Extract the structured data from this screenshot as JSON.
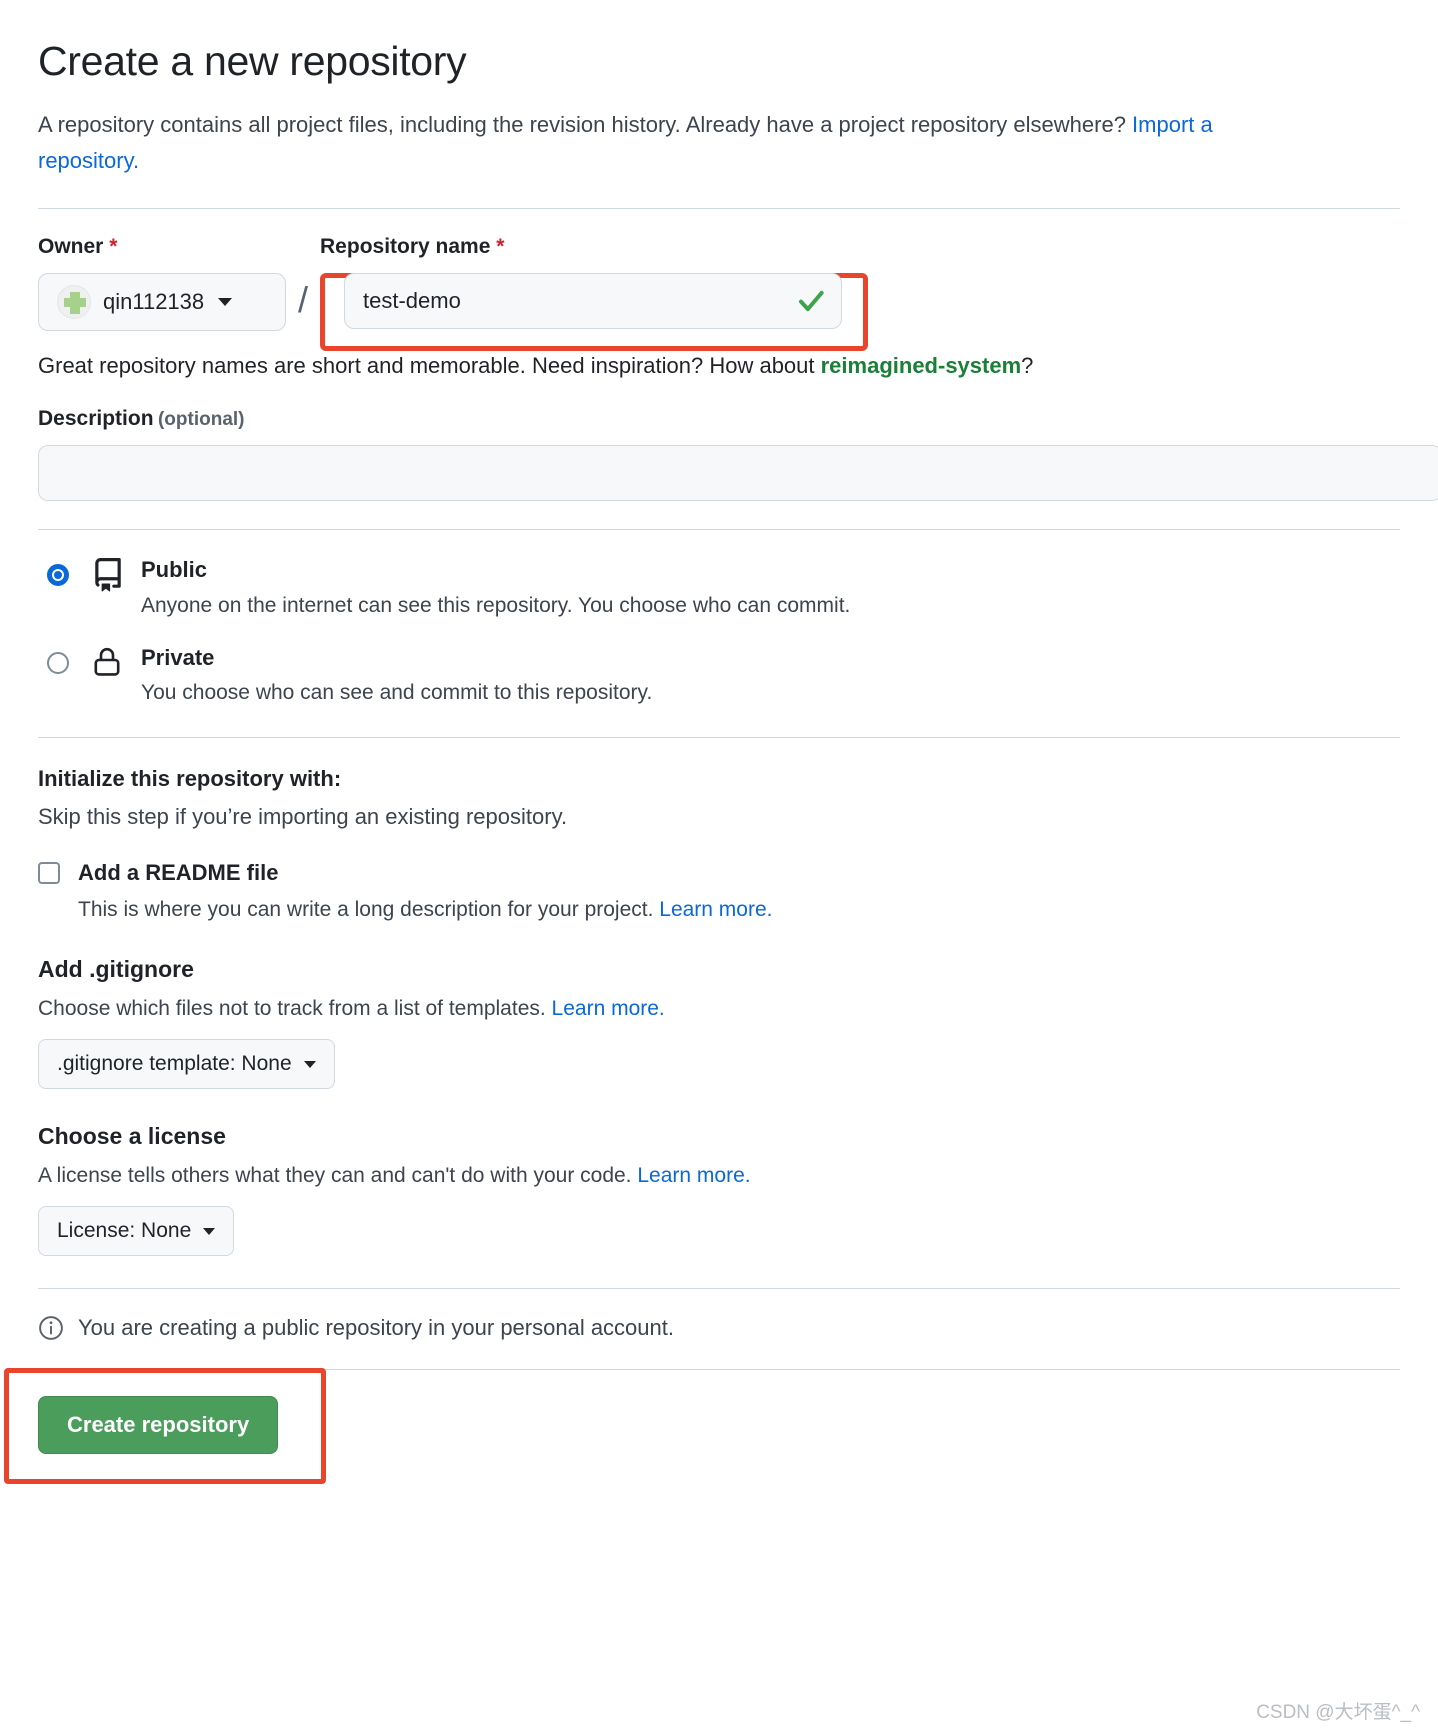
{
  "header": {
    "title": "Create a new repository",
    "subtitle_part1": "A repository contains all project files, including the revision history. Already have a project repository elsewhere? ",
    "import_link": "Import a repository."
  },
  "owner": {
    "label": "Owner",
    "required_mark": "*",
    "value": "qin112138",
    "separator": "/"
  },
  "repo_name": {
    "label": "Repository name",
    "required_mark": "*",
    "value": "test-demo",
    "placeholder": "",
    "valid_icon": "check-icon"
  },
  "hint": {
    "prefix": "Great repository names are short and memorable. Need inspiration? How about ",
    "suggestion": "reimagined-system",
    "suffix": "?"
  },
  "description": {
    "label": "Description",
    "optional": "(optional)",
    "value": "",
    "placeholder": ""
  },
  "visibility": [
    {
      "id": "public",
      "icon": "repo-book-icon",
      "title": "Public",
      "description": "Anyone on the internet can see this repository. You choose who can commit.",
      "selected": true
    },
    {
      "id": "private",
      "icon": "lock-icon",
      "title": "Private",
      "description": "You choose who can see and commit to this repository.",
      "selected": false
    }
  ],
  "initialize": {
    "title": "Initialize this repository with:",
    "subtitle": "Skip this step if you’re importing an existing repository.",
    "readme": {
      "label": "Add a README file",
      "checked": false,
      "description": "This is where you can write a long description for your project. ",
      "learn_more": "Learn more."
    },
    "gitignore": {
      "title": "Add .gitignore",
      "description": "Choose which files not to track from a list of templates. ",
      "learn_more": "Learn more.",
      "dropdown_label": ".gitignore template: None"
    },
    "license": {
      "title": "Choose a license",
      "description": "A license tells others what they can and can't do with your code. ",
      "learn_more": "Learn more.",
      "dropdown_label": "License: None"
    }
  },
  "footer": {
    "notice_icon": "info-icon",
    "notice": "You are creating a public repository in your personal account.",
    "create_button": "Create repository"
  },
  "watermark": "CSDN @大坏蛋^_^",
  "colors": {
    "accent_blue": "#0969da",
    "success_green": "#1a7f37",
    "button_green": "#4a9d5b",
    "highlight_red": "#e8452c",
    "required_red": "#cf222e"
  }
}
